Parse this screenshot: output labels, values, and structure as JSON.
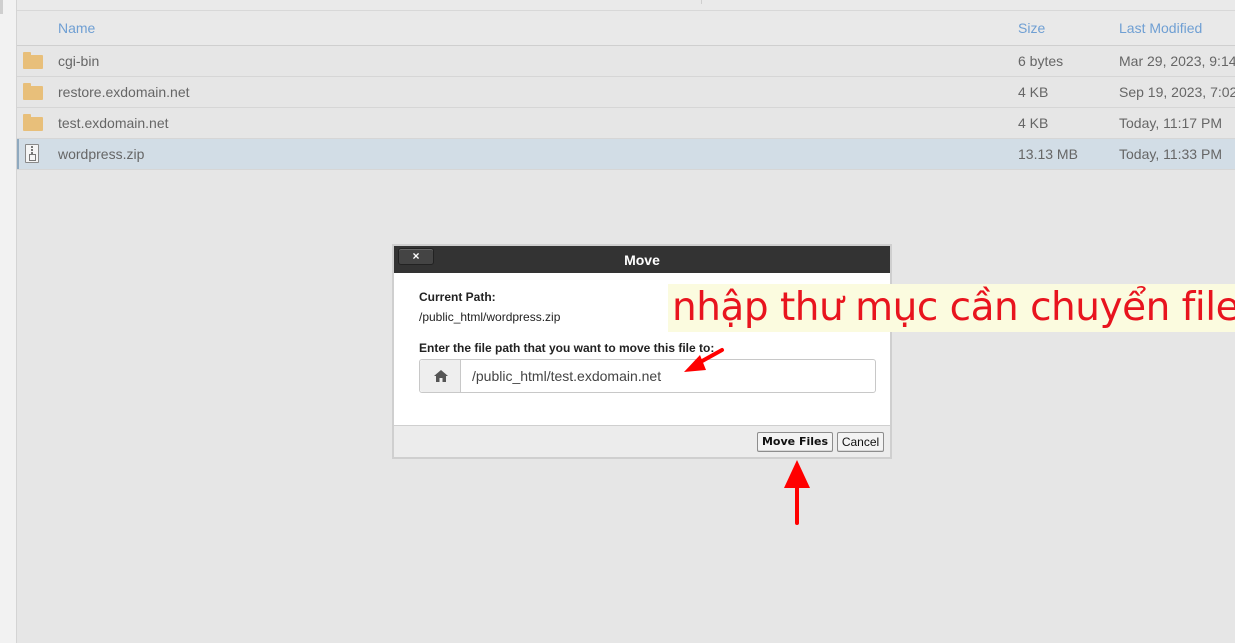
{
  "file_table": {
    "headers": {
      "name": "Name",
      "size": "Size",
      "last_modified": "Last Modified"
    },
    "rows": [
      {
        "icon": "folder-icon",
        "name": "cgi-bin",
        "size": "6 bytes",
        "modified": "Mar 29, 2023, 9:14"
      },
      {
        "icon": "folder-icon",
        "name": "restore.exdomain.net",
        "size": "4 KB",
        "modified": "Sep 19, 2023, 7:02"
      },
      {
        "icon": "folder-icon",
        "name": "test.exdomain.net",
        "size": "4 KB",
        "modified": "Today, 11:17 PM"
      },
      {
        "icon": "zip-file-icon",
        "name": "wordpress.zip",
        "size": "13.13 MB",
        "modified": "Today, 11:33 PM",
        "selected": true
      }
    ]
  },
  "dialog": {
    "title": "Move",
    "close_label": "×",
    "current_path_label": "Current Path:",
    "current_path_value": "/public_html/wordpress.zip",
    "prompt": "Enter the file path that you want to move this file to:",
    "path_input_value": "/public_html/test.exdomain.net",
    "home_icon": "home-icon",
    "move_button": "Move Files",
    "cancel_button": "Cancel"
  },
  "annotation": {
    "text": "nhập thư mục cần chuyển file",
    "color": "#e8141e"
  },
  "colors": {
    "header_text": "#6f9fd3",
    "selected_row": "#d2dde6",
    "folder": "#e8bf7a",
    "titlebar": "#333333"
  }
}
